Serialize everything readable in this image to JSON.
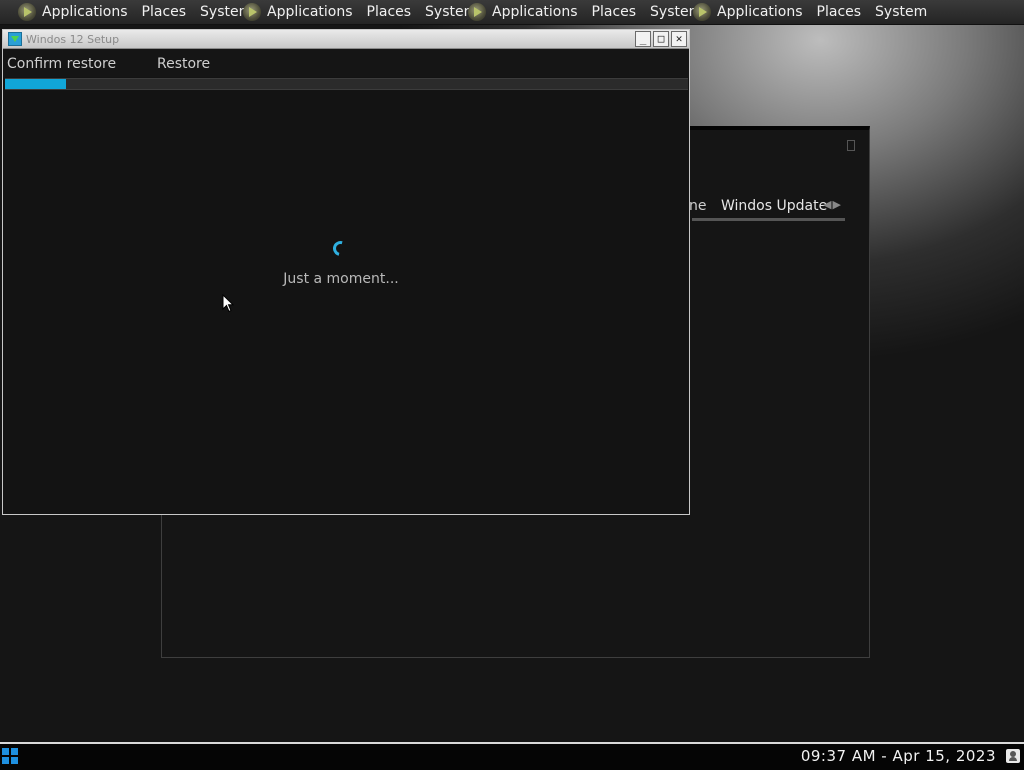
{
  "top_panel": {
    "groups": [
      {
        "applications": "Applications",
        "places": "Places",
        "system": "System"
      },
      {
        "applications": "Applications",
        "places": "Places",
        "system": "System"
      },
      {
        "applications": "Applications",
        "places": "Places",
        "system": "System"
      },
      {
        "applications": "Applications",
        "places": "Places",
        "system": "System"
      }
    ]
  },
  "background_window": {
    "tab_partial": "ne",
    "tab_active": "Windos Update",
    "tab_scroll_arrows": "◀▶"
  },
  "setup_window": {
    "title": "Windos 12 Setup",
    "buttons": {
      "minimize": "_",
      "maximize": "□",
      "close": "✕"
    },
    "steps": [
      "Confirm restore",
      "Restore"
    ],
    "progress_percent": 9,
    "status_text": "Just a moment..."
  },
  "taskbar": {
    "clock": "09:37 AM - Apr 15, 2023"
  },
  "colors": {
    "accent": "#11a6d8",
    "start_button": "#1e90e0"
  }
}
